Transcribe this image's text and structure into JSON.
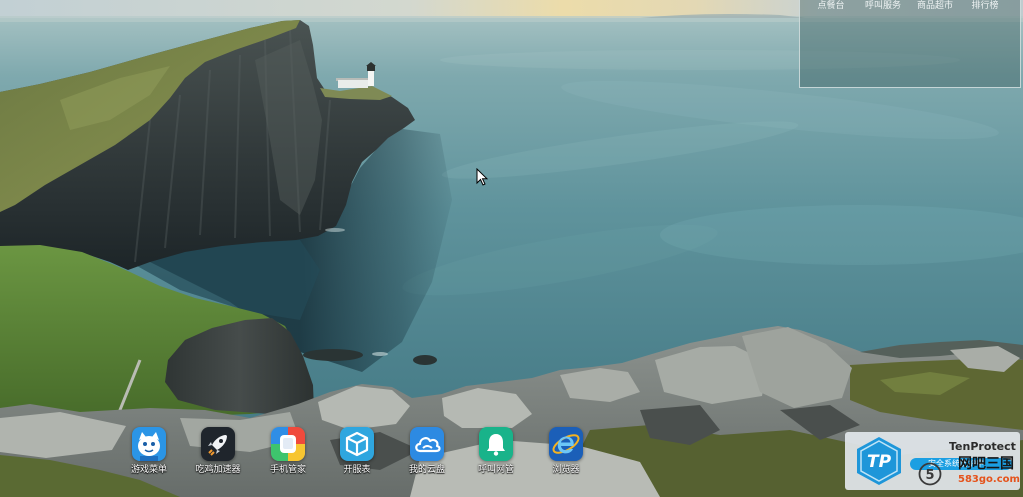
{
  "top_menu": {
    "items": [
      {
        "label": "点餐台"
      },
      {
        "label": "呼叫服务"
      },
      {
        "label": "商品超市"
      },
      {
        "label": "排行榜"
      }
    ]
  },
  "dock": {
    "items": [
      {
        "label": "游戏菜单",
        "icon": "mascot-icon",
        "color": "#2b95e6"
      },
      {
        "label": "吃鸡加速器",
        "icon": "rocket-icon",
        "color": "#1f252c"
      },
      {
        "label": "手机管家",
        "icon": "phone-manager-icon",
        "colors": [
          "#f04a3c",
          "#f7c531",
          "#3ec46d",
          "#2f8ee6"
        ]
      },
      {
        "label": "开服表",
        "icon": "cube-icon",
        "color": "#2fa6df"
      },
      {
        "label": "我的云盘",
        "icon": "cloud-icon",
        "color": "#2d8ae2"
      },
      {
        "label": "呼叫网管",
        "icon": "bell-icon",
        "color": "#19b38a"
      },
      {
        "label": "浏览器",
        "icon": "ie-browser-icon",
        "color": "#1b5fb8"
      }
    ]
  },
  "tenprotect": {
    "brand": "TenProtect",
    "logo_text": "TP",
    "status": "安全系统防护中",
    "accent": "#1b9fe2",
    "logo_color": "#1e96d9"
  },
  "watermark": {
    "name": "网吧三国",
    "url": "583go.com",
    "logo_glyph": "5",
    "url_color": "#e5531c"
  },
  "icons": {
    "cursor": "arrow-cursor-icon",
    "tenprotect_logo": "tp-shield-icon",
    "watermark_logo": "circle-5-logo-icon"
  }
}
